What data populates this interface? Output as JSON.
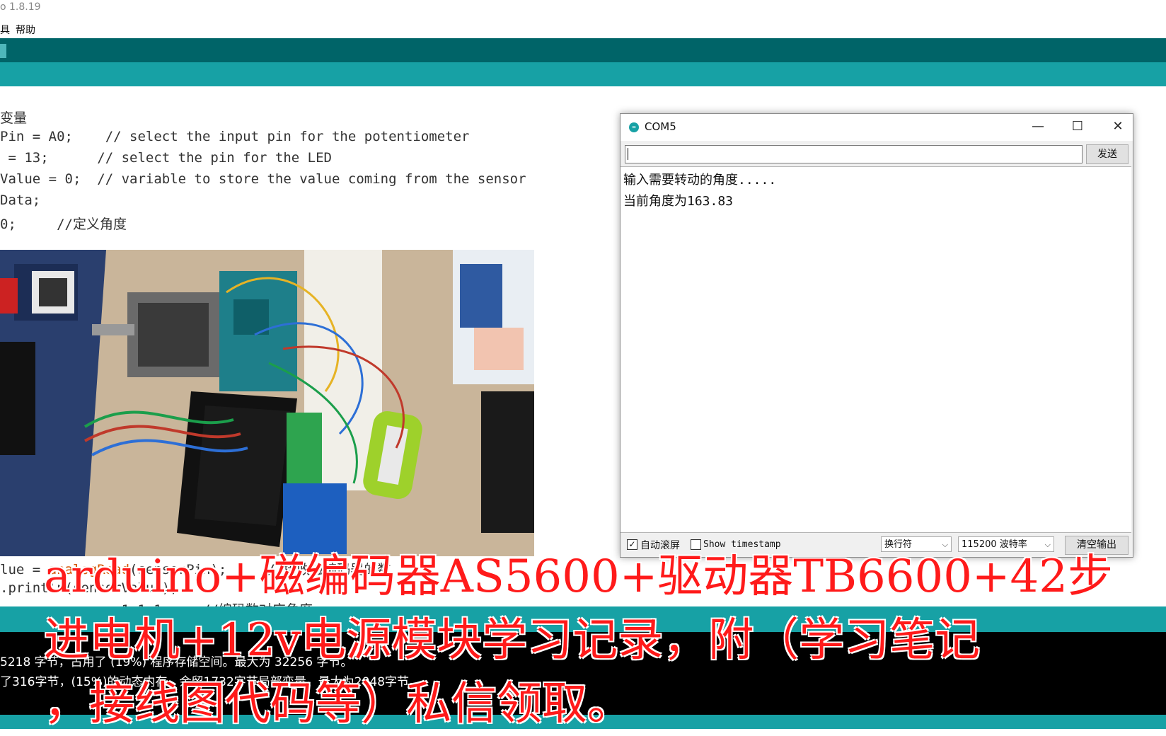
{
  "window": {
    "title": "o 1.8.19"
  },
  "menu": {
    "items": [
      "具",
      "帮助"
    ]
  },
  "editor": {
    "lines": [
      "变量",
      "Pin = A0;    // select the input pin for the potentiometer",
      " = 13;      // select the pin for the LED",
      "Value = 0;  // variable to store the value coming from the sensor",
      "Data;",
      "0;     //定义角度"
    ],
    "bottom_lines": {
      "l1_prefix": "lue = ",
      "l1_func": "analogRead",
      "l1_rest": "(sensorPin);     //接收磁编码器的数",
      "l2": ".println(sensorValue);",
      "l3": "        .      1.1.1.    //编码数对应角度"
    }
  },
  "console": {
    "lines": [
      "5218 字节，占用了 (19%) 程序存储空间。最大为 32256 字节。",
      "了316字节，(15%)的动态内存，余留1732字节局部变量。最大为2048字节。"
    ]
  },
  "serial_monitor": {
    "title": "COM5",
    "send_label": "发送",
    "input_value": "",
    "output_lines": [
      "输入需要转动的角度.....",
      "当前角度为163.83"
    ],
    "autoscroll_label": "自动滚屏",
    "autoscroll_checked": "✓",
    "timestamp_label": "Show timestamp",
    "line_ending": "换行符",
    "baud": "115200 波特率",
    "clear_label": "清空输出",
    "minimize_glyph": "—",
    "maximize_glyph": "☐",
    "close_glyph": "✕"
  },
  "overlay": {
    "lines": [
      "arduino+磁编码器AS5600+驱动器TB6600+42步",
      "进电机+12v电源模块学习记录，附（学习笔记",
      "，接线图代码等）私信领取。"
    ]
  },
  "colors": {
    "toolbar": "#006468",
    "tabbar": "#17a1a5",
    "overlay_text": "#ff1a1a",
    "console_bg": "#000000"
  }
}
